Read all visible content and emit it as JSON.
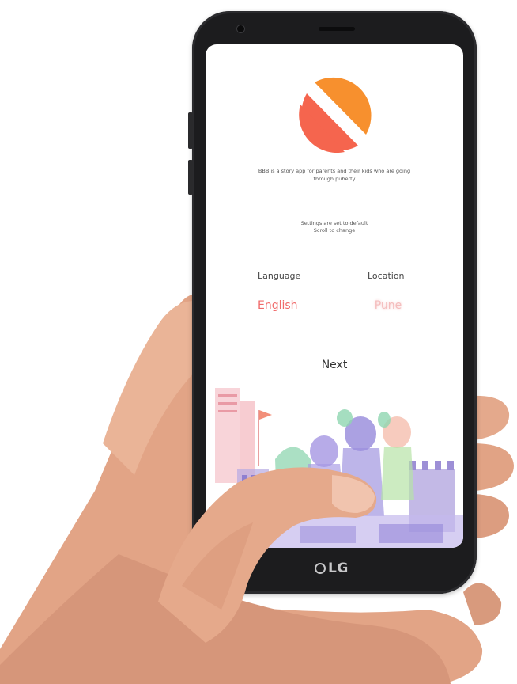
{
  "app": {
    "tagline": "BBB is a story app for parents and their kids who are going through puberty",
    "settings_note_line1": "Settings are set to default",
    "settings_note_line2": "Scroll to change",
    "language_label": "Language",
    "language_value": "English",
    "location_label": "Location",
    "location_value": "Pune",
    "next_label": "Next"
  },
  "device": {
    "brand": "LG"
  },
  "colors": {
    "logo_orange": "#f7902e",
    "logo_red": "#f5654e",
    "selected_value": "#f06a6a",
    "phone_body": "#1c1c1e"
  },
  "icons": {
    "app_logo": "split-circle-logo-icon",
    "brand_logo": "lg-logo-icon"
  }
}
